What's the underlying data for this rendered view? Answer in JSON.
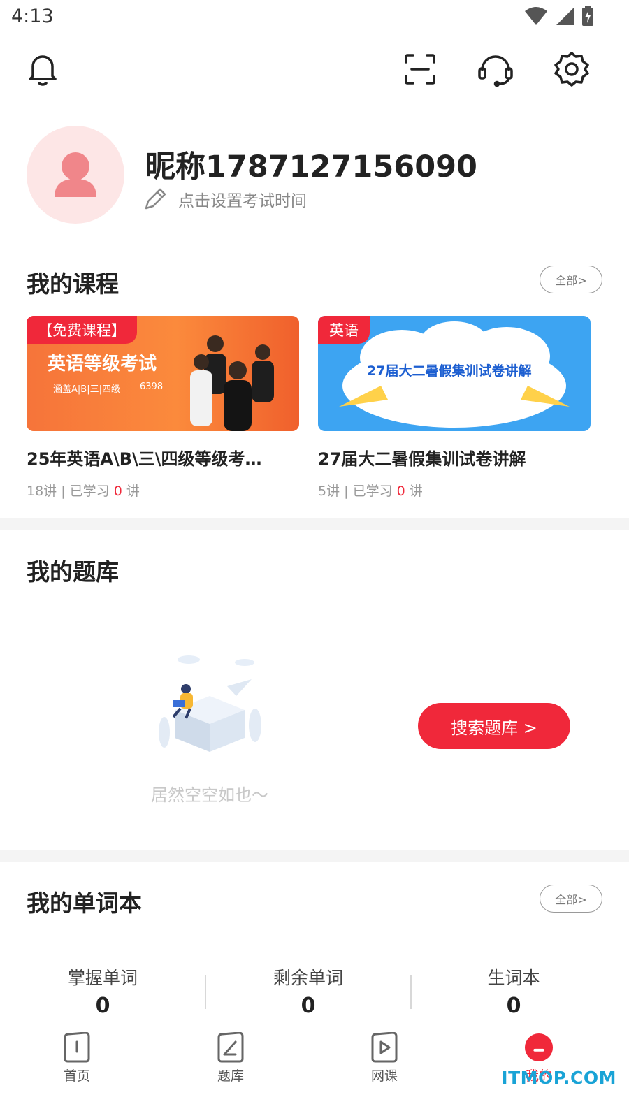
{
  "status_bar": {
    "time": "4:13",
    "icons": [
      "wifi-icon",
      "signal-icon",
      "battery-icon"
    ]
  },
  "header": {
    "icons": [
      "bell-icon",
      "scan-icon",
      "headset-icon",
      "settings-icon"
    ]
  },
  "profile": {
    "nickname": "昵称1787127156090",
    "exam_prompt": "点击设置考试时间"
  },
  "courses": {
    "title": "我的课程",
    "all_label": "全部>",
    "items": [
      {
        "tag": "【免费课程】",
        "thumb_headline": "英语等级考试",
        "thumb_sub": "涵盖A|B|三|四级",
        "thumb_count": "6398",
        "title": "25年英语A\\B\\三\\四级等级考…",
        "lessons": "18讲 | 已学习 ",
        "studied": "0",
        "unit": " 讲"
      },
      {
        "tag": "英语",
        "thumb_headline": "27届大二暑假集训试卷讲解",
        "title": "27届大二暑假集训试卷讲解",
        "lessons": "5讲 | 已学习 ",
        "studied": "0",
        "unit": " 讲"
      }
    ]
  },
  "question_bank": {
    "title": "我的题库",
    "empty_text": "居然空空如也～",
    "search_label": "搜索题库 >"
  },
  "wordbook": {
    "title": "我的单词本",
    "all_label": "全部>",
    "stats": [
      {
        "label": "掌握单词",
        "value": "0"
      },
      {
        "label": "剩余单词",
        "value": "0"
      },
      {
        "label": "生词本",
        "value": "0"
      }
    ]
  },
  "tabbar": {
    "items": [
      {
        "label": "首页"
      },
      {
        "label": "题库"
      },
      {
        "label": "网课"
      },
      {
        "label": "我的"
      }
    ],
    "active": "我的"
  },
  "watermark": "ITMOP.COM",
  "colors": {
    "accent": "#f0283a",
    "avatar_bg": "#fde6e6",
    "divider": "#f4f4f4",
    "watermark": "#19a3d6"
  }
}
